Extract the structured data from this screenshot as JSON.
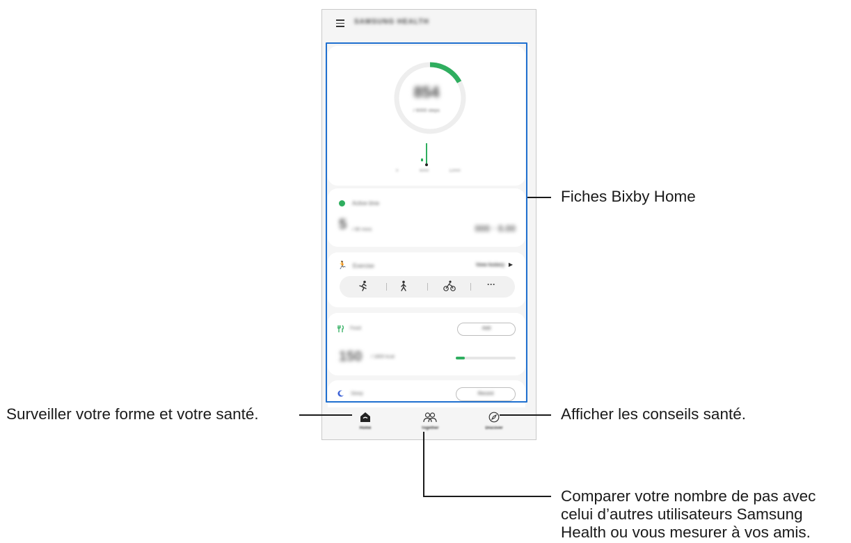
{
  "app": {
    "title": "SAMSUNG HEALTH"
  },
  "steps": {
    "count": "854",
    "goal": "/ 6000 steps",
    "progress_fraction": 0.17,
    "axis_labels": [
      "0",
      "6000",
      "12000"
    ]
  },
  "active_zone": {
    "title": "Active time",
    "value": "5",
    "goal": "/ 90 mins",
    "right_value": "000 · 0.00"
  },
  "exercise": {
    "title": "Exercise",
    "history_label": "View history",
    "history_arrow": "▶",
    "activities": [
      "running-icon",
      "walking-icon",
      "cycling-icon",
      "more-icon"
    ]
  },
  "food": {
    "title": "Food",
    "record_label": "Add",
    "value": "150",
    "goal": "/ 1800 kcal",
    "progress_fraction": 0.15
  },
  "sleep": {
    "title": "Sleep",
    "record_label": "Record"
  },
  "nav": {
    "items": [
      {
        "label": "Home",
        "icon": "home-icon"
      },
      {
        "label": "Together",
        "icon": "together-icon"
      },
      {
        "label": "Discover",
        "icon": "compass-icon"
      }
    ]
  },
  "callouts": {
    "cards": "Fiches Bixby Home",
    "home": "Surveiller votre forme et votre santé.",
    "discover": "Afficher les conseils santé.",
    "together_line1": "Comparer votre nombre de pas avec",
    "together_line2": "celui d’autres utilisateurs Samsung",
    "together_line3": "Health ou vous mesurer à vos amis."
  },
  "colors": {
    "accent_green": "#2fae5f",
    "highlight_blue": "#1e6fcf",
    "sleep_blue": "#3c62d6"
  }
}
